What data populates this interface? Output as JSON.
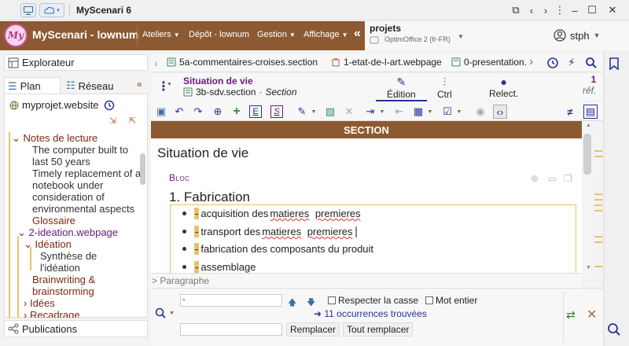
{
  "app": {
    "title": "MyScenari 6",
    "brand": "MyScenari - lownum",
    "logo_text": "My"
  },
  "nav": [
    {
      "label": "Ateliers"
    },
    {
      "label": "Dépôt - lownum"
    },
    {
      "label": "Gestion"
    },
    {
      "label": "Affichage"
    }
  ],
  "workspace": {
    "title": "projets",
    "subtitle": "OptimOffice 2 (fr-FR)"
  },
  "user": {
    "name": "stph"
  },
  "left": {
    "explorer_label": "Explorateur",
    "plan_label": "Plan",
    "reseau_label": "Réseau",
    "root": "myprojet.website",
    "tree": [
      {
        "label": "Notes de lecture"
      },
      {
        "label": "The computer built to last 50 years"
      },
      {
        "label": "Timely replacement of a notebook under consideration of environmental aspects"
      },
      {
        "label": "Glossaire"
      },
      {
        "label": "2-ideation.webpage"
      },
      {
        "label": "Idéation"
      },
      {
        "label": "Synthèse de l'idéation"
      },
      {
        "label": "Brainwriting & brainstorming"
      },
      {
        "label": "Idées"
      },
      {
        "label": "Recadrage"
      }
    ],
    "publications_label": "Publications"
  },
  "tabs": [
    {
      "label": "5a-commentaires-croises.section"
    },
    {
      "label": "1-etat-de-l-art.webpage"
    },
    {
      "label": "0-presentation."
    }
  ],
  "doc": {
    "title": "Situation de vie",
    "file": "3b-sdv.section",
    "type": "Section",
    "modes": [
      {
        "label": "Édition"
      },
      {
        "label": "Ctrl"
      },
      {
        "label": "Relect."
      }
    ],
    "ref_count": "1",
    "ref_label": "réf."
  },
  "editor": {
    "section_band": "SECTION",
    "title": "Situation de vie",
    "bloc": "Bloc",
    "heading": "1. Fabrication",
    "items": [
      {
        "mark": "-",
        "text": "acquisition des ",
        "w1": "matieres",
        "sp": " ",
        "w2": "premieres",
        "tail": ""
      },
      {
        "mark": "-",
        "text": "transport des ",
        "w1": "matieres",
        "sp": " ",
        "w2": "premieres",
        "tail": ""
      },
      {
        "mark": "-",
        "text": "fabrication des composants du produit",
        "w1": "",
        "sp": "",
        "w2": "",
        "tail": ""
      },
      {
        "mark": "-",
        "text": "assemblage",
        "w1": "",
        "sp": "",
        "w2": "",
        "tail": ""
      }
    ],
    "status": "> Paragraphe"
  },
  "find": {
    "search_value": "-",
    "match_case": "Respecter la casse",
    "whole_word": "Mot entier",
    "occurrences": "➜ 11 occurrences trouvées",
    "replace_label": "Remplacer",
    "replace_all_label": "Tout remplacer"
  },
  "colors": {
    "accent": "#8c5a32",
    "purple": "#6a1b80",
    "highlight": "#e6c36b"
  }
}
